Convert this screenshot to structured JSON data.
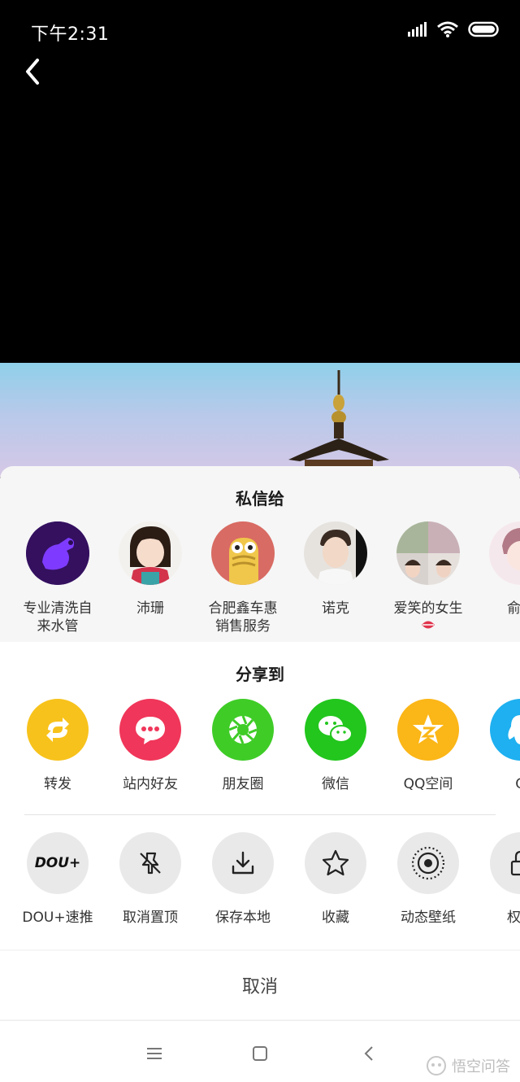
{
  "status": {
    "time": "下午2:31"
  },
  "private_message": {
    "title": "私信给",
    "contacts": [
      {
        "name": "专业清洗自来水管"
      },
      {
        "name": "沛珊"
      },
      {
        "name": "合肥鑫车惠销售服务"
      },
      {
        "name": "诺克"
      },
      {
        "name": "爱笑的女生"
      },
      {
        "name": "俞先"
      }
    ]
  },
  "share": {
    "title": "分享到",
    "apps": [
      {
        "label": "转发",
        "color": "#f7c21b"
      },
      {
        "label": "站内好友",
        "color": "#f0365a"
      },
      {
        "label": "朋友圈",
        "color": "#3fcc27"
      },
      {
        "label": "微信",
        "color": "#22c61d"
      },
      {
        "label": "QQ空间",
        "color": "#fbb617"
      },
      {
        "label": "Q",
        "color": "#1eb0f0"
      }
    ]
  },
  "actions": [
    {
      "label": "DOU+速推",
      "icon_text": "DOU+"
    },
    {
      "label": "取消置顶"
    },
    {
      "label": "保存本地"
    },
    {
      "label": "收藏"
    },
    {
      "label": "动态壁纸"
    },
    {
      "label": "权限"
    }
  ],
  "cancel_label": "取消",
  "watermark": "悟空问答"
}
